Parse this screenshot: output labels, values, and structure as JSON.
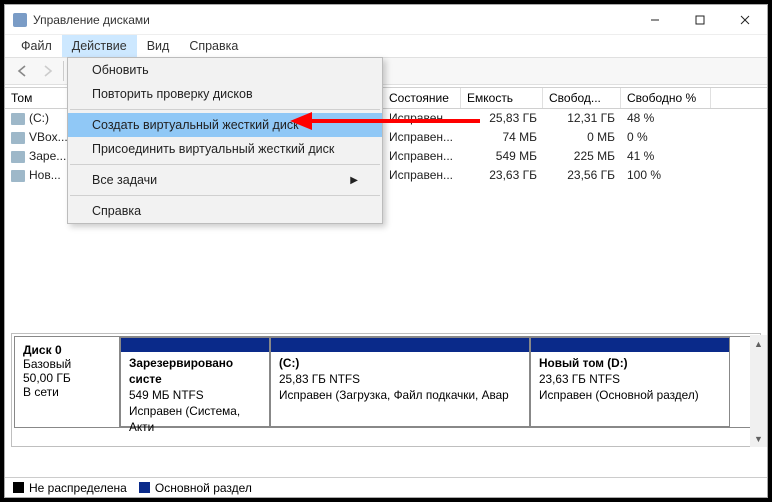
{
  "window_title": "Управление дисками",
  "menubar": {
    "file": "Файл",
    "action": "Действие",
    "view": "Вид",
    "help": "Справка"
  },
  "dropdown": {
    "refresh": "Обновить",
    "rescan": "Повторить проверку дисков",
    "create_vhd": "Создать виртуальный жесткий диск",
    "attach_vhd": "Присоединить виртуальный жесткий диск",
    "all_tasks": "Все задачи",
    "help": "Справка"
  },
  "columns": {
    "volume": "Том",
    "state": "Состояние",
    "capacity": "Емкость",
    "free": "Свобод...",
    "free_pct": "Свободно %"
  },
  "rows": [
    {
      "vol": "(C:)",
      "state": "Исправен...",
      "cap": "25,83 ГБ",
      "free": "12,31 ГБ",
      "pct": "48 %"
    },
    {
      "vol": "VBox...",
      "state": "Исправен...",
      "cap": "74 МБ",
      "free": "0 МБ",
      "pct": "0 %"
    },
    {
      "vol": "Заре...",
      "state": "Исправен...",
      "cap": "549 МБ",
      "free": "225 МБ",
      "pct": "41 %"
    },
    {
      "vol": "Нов...",
      "state": "Исправен...",
      "cap": "23,63 ГБ",
      "free": "23,56 ГБ",
      "pct": "100 %"
    }
  ],
  "disk": {
    "label": "Диск 0",
    "type": "Базовый",
    "size": "50,00 ГБ",
    "status": "В сети",
    "partitions": [
      {
        "title": "Зарезервировано систе",
        "line2": "549 МБ NTFS",
        "line3": "Исправен (Система, Акти"
      },
      {
        "title": "(C:)",
        "line2": "25,83 ГБ NTFS",
        "line3": "Исправен (Загрузка, Файл подкачки, Авар"
      },
      {
        "title": "Новый том  (D:)",
        "line2": "23,63 ГБ NTFS",
        "line3": "Исправен (Основной раздел)"
      }
    ]
  },
  "legend": {
    "unallocated": "Не распределена",
    "primary": "Основной раздел"
  }
}
